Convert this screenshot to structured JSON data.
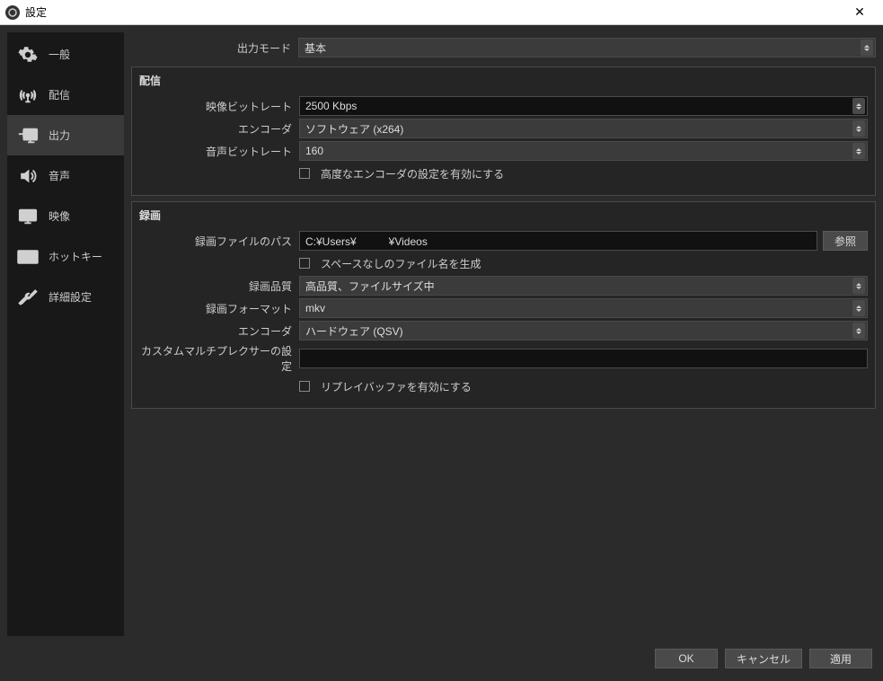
{
  "window": {
    "title": "設定"
  },
  "sidebar": {
    "items": [
      {
        "label": "一般"
      },
      {
        "label": "配信"
      },
      {
        "label": "出力"
      },
      {
        "label": "音声"
      },
      {
        "label": "映像"
      },
      {
        "label": "ホットキー"
      },
      {
        "label": "詳細設定"
      }
    ]
  },
  "topRow": {
    "outputModeLabel": "出力モード",
    "outputModeValue": "基本"
  },
  "streamPanel": {
    "title": "配信",
    "videoBitrateLabel": "映像ビットレート",
    "videoBitrateValue": "2500 Kbps",
    "encoderLabel": "エンコーダ",
    "encoderValue": "ソフトウェア (x264)",
    "audioBitrateLabel": "音声ビットレート",
    "audioBitrateValue": "160",
    "advancedCheckboxLabel": "高度なエンコーダの設定を有効にする"
  },
  "recordPanel": {
    "title": "録画",
    "pathLabel": "録画ファイルのパス",
    "pathValue": "C:¥Users¥　　　¥Videos",
    "browseBtn": "参照",
    "noSpaceCheckboxLabel": "スペースなしのファイル名を生成",
    "qualityLabel": "録画品質",
    "qualityValue": "高品質、ファイルサイズ中",
    "formatLabel": "録画フォーマット",
    "formatValue": "mkv",
    "encoderLabel": "エンコーダ",
    "encoderValue": "ハードウェア (QSV)",
    "muxerLabel": "カスタムマルチプレクサーの設定",
    "muxerValue": "",
    "replayBufferLabel": "リプレイバッファを有効にする"
  },
  "footer": {
    "ok": "OK",
    "cancel": "キャンセル",
    "apply": "適用"
  }
}
